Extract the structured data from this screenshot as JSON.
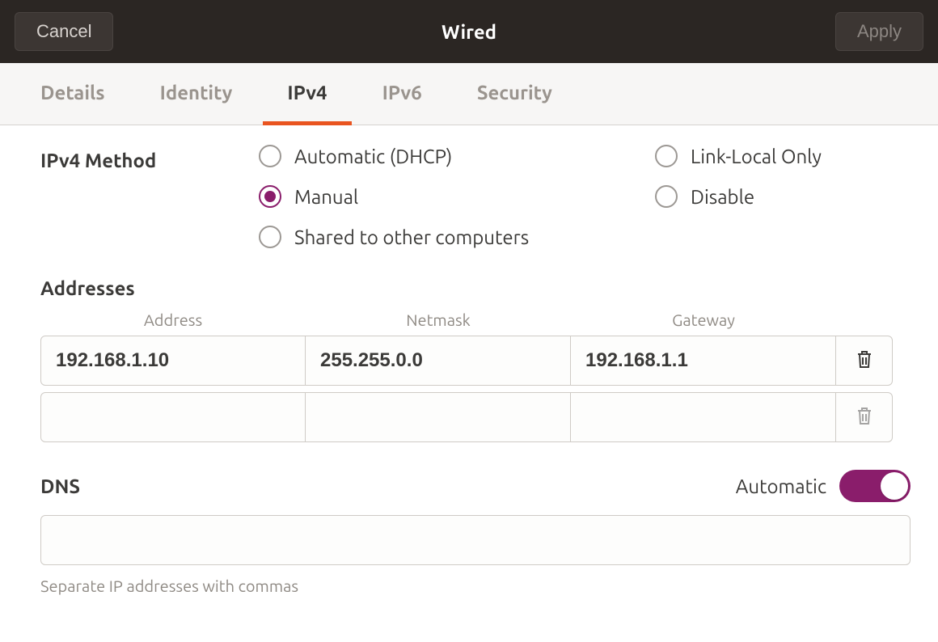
{
  "titlebar": {
    "cancel": "Cancel",
    "title": "Wired",
    "apply": "Apply"
  },
  "tabs": {
    "details": "Details",
    "identity": "Identity",
    "ipv4": "IPv4",
    "ipv6": "IPv6",
    "security": "Security",
    "active": "ipv4"
  },
  "ipv4": {
    "method_label": "IPv4 Method",
    "options": {
      "dhcp": "Automatic (DHCP)",
      "link_local": "Link-Local Only",
      "manual": "Manual",
      "disable": "Disable",
      "shared": "Shared to other computers"
    },
    "selected": "manual"
  },
  "addresses": {
    "title": "Addresses",
    "headers": {
      "address": "Address",
      "netmask": "Netmask",
      "gateway": "Gateway"
    },
    "rows": [
      {
        "address": "192.168.1.10",
        "netmask": "255.255.0.0",
        "gateway": "192.168.1.1"
      },
      {
        "address": "",
        "netmask": "",
        "gateway": ""
      }
    ]
  },
  "dns": {
    "label": "DNS",
    "automatic_label": "Automatic",
    "automatic_on": true,
    "value": "",
    "hint": "Separate IP addresses with commas"
  }
}
